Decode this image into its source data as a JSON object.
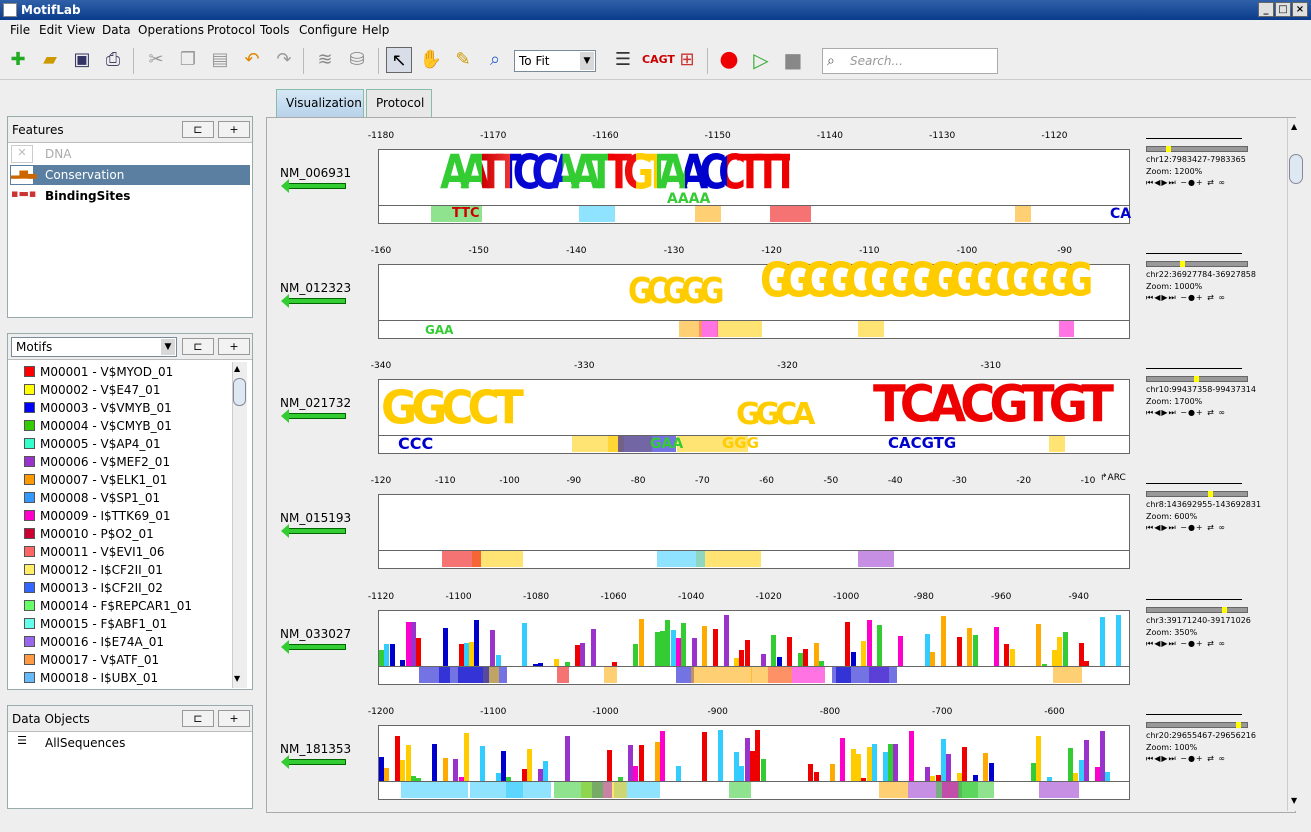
{
  "window": {
    "title": "MotifLab"
  },
  "menu": [
    "File",
    "Edit",
    "View",
    "Data",
    "Operations",
    "Protocol",
    "Tools",
    "Configure",
    "Help"
  ],
  "toolbar": {
    "zoom_value": "To Fit",
    "search_placeholder": "Search..."
  },
  "features": {
    "title": "Features",
    "items": [
      {
        "label": "DNA",
        "icon": "dna-disabled-icon"
      },
      {
        "label": "Conservation",
        "icon": "conservation-graph-icon"
      },
      {
        "label": "BindingSites",
        "icon": "region-track-icon"
      }
    ]
  },
  "motifs": {
    "selector": "Motifs",
    "items": [
      {
        "label": "M00001 - V$MYOD_01",
        "color": "#ff0000"
      },
      {
        "label": "M00002 - V$E47_01",
        "color": "#ffff00"
      },
      {
        "label": "M00003 - V$VMYB_01",
        "color": "#0000ff"
      },
      {
        "label": "M00004 - V$CMYB_01",
        "color": "#33cc00"
      },
      {
        "label": "M00005 - V$AP4_01",
        "color": "#33ffcc"
      },
      {
        "label": "M00006 - V$MEF2_01",
        "color": "#9933cc"
      },
      {
        "label": "M00007 - V$ELK1_01",
        "color": "#ff9900"
      },
      {
        "label": "M00008 - V$SP1_01",
        "color": "#3399ff"
      },
      {
        "label": "M00009 - I$TTK69_01",
        "color": "#ff00cc"
      },
      {
        "label": "M00010 - P$O2_01",
        "color": "#cc0033"
      },
      {
        "label": "M00011 - V$EVI1_06",
        "color": "#ff6666"
      },
      {
        "label": "M00012 - I$CF2II_01",
        "color": "#ffee66"
      },
      {
        "label": "M00013 - I$CF2II_02",
        "color": "#3366ff"
      },
      {
        "label": "M00014 - F$REPCAR1_01",
        "color": "#66ff66"
      },
      {
        "label": "M00015 - F$ABF1_01",
        "color": "#66ffee"
      },
      {
        "label": "M00016 - I$E74A_01",
        "color": "#9966ee"
      },
      {
        "label": "M00017 - V$ATF_01",
        "color": "#ff9944"
      },
      {
        "label": "M00018 - I$UBX_01",
        "color": "#66bbff"
      }
    ]
  },
  "data_objects": {
    "title": "Data Objects",
    "items": [
      {
        "label": "AllSequences"
      }
    ]
  },
  "tabs": [
    {
      "label": "Visualization",
      "selected": true
    },
    {
      "label": "Protocol",
      "selected": false
    }
  ],
  "sequences": [
    {
      "name": "NM_006931",
      "ticks": [
        "-1180",
        "-1170",
        "-1160",
        "-1150",
        "-1140",
        "-1130",
        "-1120"
      ],
      "loc": "chr12:7983427-7983365",
      "zoom": "Zoom:   1200%"
    },
    {
      "name": "NM_012323",
      "ticks": [
        "-160",
        "-150",
        "-140",
        "-130",
        "-120",
        "-110",
        "-100",
        "-90"
      ],
      "loc": "chr22:36927784-36927858",
      "zoom": "Zoom:   1000%"
    },
    {
      "name": "NM_021732",
      "ticks": [
        "-340",
        "-330",
        "-320",
        "-310"
      ],
      "loc": "chr10:99437358-99437314",
      "zoom": "Zoom:   1700%"
    },
    {
      "name": "NM_015193",
      "ticks": [
        "-120",
        "-110",
        "-100",
        "-90",
        "-80",
        "-70",
        "-60",
        "-50",
        "-40",
        "-30",
        "-20",
        "-10"
      ],
      "loc": "chr8:143692955-143692831",
      "zoom": "Zoom:   600%",
      "tss": "ARC"
    },
    {
      "name": "NM_033027",
      "ticks": [
        "-1120",
        "-1100",
        "-1080",
        "-1060",
        "-1040",
        "-1020",
        "-1000",
        "-980",
        "-960",
        "-940"
      ],
      "loc": "chr3:39171240-39171026",
      "zoom": "Zoom:   350%"
    },
    {
      "name": "NM_181353",
      "ticks": [
        "-1200",
        "-1100",
        "-1000",
        "-900",
        "-800",
        "-700",
        "-600"
      ],
      "loc": "chr20:29655467-29656216",
      "zoom": "Zoom:   100%"
    }
  ],
  "logos": {
    "s1": "AATTCCAATTGTAACCTTT",
    "s1b": "TTC",
    "s1c": "AAAA",
    "s1d": "CA",
    "s2a": "GCGGG",
    "s2b": "GGGGCGGGG",
    "s2c": "GGGCGGGG",
    "s2d": "GAA",
    "s3a": "GGCCT",
    "s3b": "GGCA",
    "s3c": "TCACGTGT",
    "s3d": "CCC",
    "s3e": "GAA",
    "s3f": "GGG",
    "s3g": "CACGTG"
  }
}
